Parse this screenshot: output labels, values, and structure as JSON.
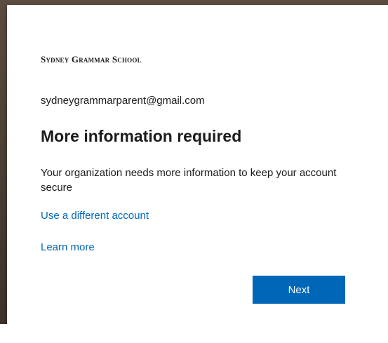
{
  "brand": {
    "logo_text": "Sydney Grammar School"
  },
  "identity": {
    "email": "sydneygrammarparent@gmail.com"
  },
  "content": {
    "title": "More information required",
    "description": "Your organization needs more information to keep your account secure"
  },
  "links": {
    "use_different_account": "Use a different account",
    "learn_more": "Learn more"
  },
  "actions": {
    "next_label": "Next"
  },
  "colors": {
    "accent": "#0067b8",
    "text": "#1b1b1b",
    "background": "#ffffff"
  }
}
